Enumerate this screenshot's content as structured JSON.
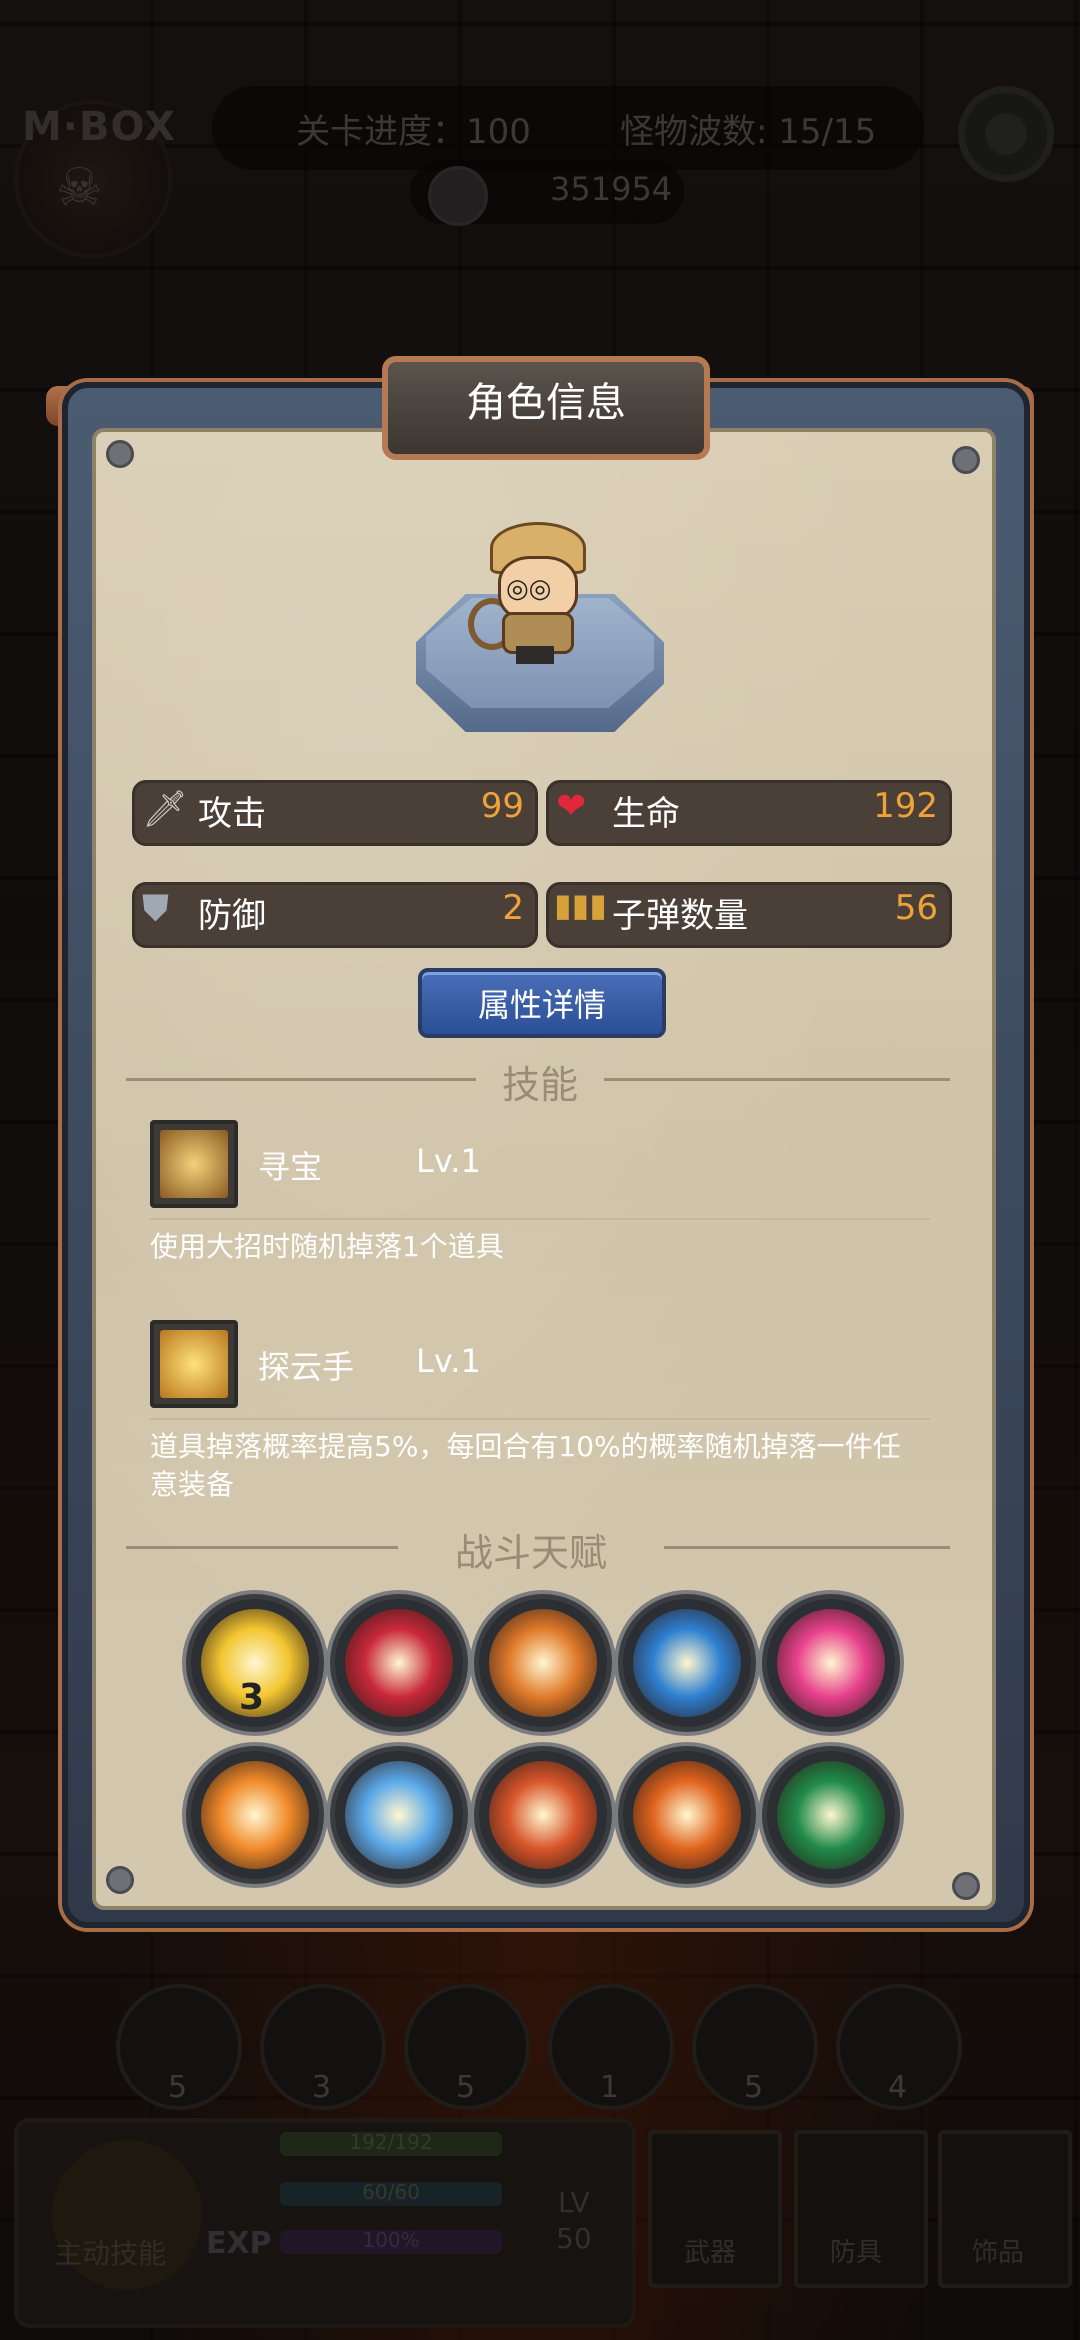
{
  "hud": {
    "logo": "M·BOX",
    "stage_progress": "关卡进度：100",
    "monster_wave": "怪物波数: 15/15",
    "coins": "351954"
  },
  "panel": {
    "title": "角色信息"
  },
  "stats": {
    "attack": {
      "label": "攻击",
      "value": "99",
      "icon": "sword-icon"
    },
    "hp": {
      "label": "生命",
      "value": "192",
      "icon": "heart-icon"
    },
    "defense": {
      "label": "防御",
      "value": "2",
      "icon": "shield-icon"
    },
    "ammo": {
      "label": "子弹数量",
      "value": "56",
      "icon": "bullets-icon"
    }
  },
  "detail_button": "属性详情",
  "skills_section": {
    "heading": "技能",
    "items": [
      {
        "name": "寻宝",
        "level": "Lv.1",
        "desc": "使用大招时随机掉落1个道具",
        "icon": "treasure-chest-icon"
      },
      {
        "name": "探云手",
        "level": "Lv.1",
        "desc": "道具掉落概率提高5%，每回合有10%的概率随机掉落一件任意装备",
        "icon": "golden-armor-icon"
      }
    ]
  },
  "talents_section": {
    "heading": "战斗天赋",
    "items": [
      {
        "icon": "sun-burst-icon",
        "count": "3",
        "color": "#f2c531"
      },
      {
        "icon": "red-cross-icon",
        "count": "",
        "color": "#c8283a"
      },
      {
        "icon": "bullet-speed-icon",
        "count": "",
        "color": "#e07a2a"
      },
      {
        "icon": "crosshair-icon",
        "count": "",
        "color": "#2e7fd0"
      },
      {
        "icon": "pink-heart-icon",
        "count": "",
        "color": "#e8418c"
      },
      {
        "icon": "explosion-icon",
        "count": "",
        "color": "#f08a2a"
      },
      {
        "icon": "ice-crystal-icon",
        "count": "",
        "color": "#5aa8e8"
      },
      {
        "icon": "fire-pillar-icon",
        "count": "",
        "color": "#d8552a"
      },
      {
        "icon": "flame-bullet-icon",
        "count": "",
        "color": "#e0641e"
      },
      {
        "icon": "pirate-skull-icon",
        "count": "",
        "color": "#1f8a4a"
      }
    ]
  },
  "bottom": {
    "slots": [
      "5",
      "3",
      "5",
      "1",
      "5",
      "4"
    ],
    "hp_text": "192/192",
    "mp_text": "60/60",
    "exp_text": "100%",
    "exp_label": "EXP",
    "lv_label": "LV",
    "lv_value": "50",
    "main_skill": "主动技能",
    "equip": [
      "武器",
      "防具",
      "饰品"
    ]
  }
}
